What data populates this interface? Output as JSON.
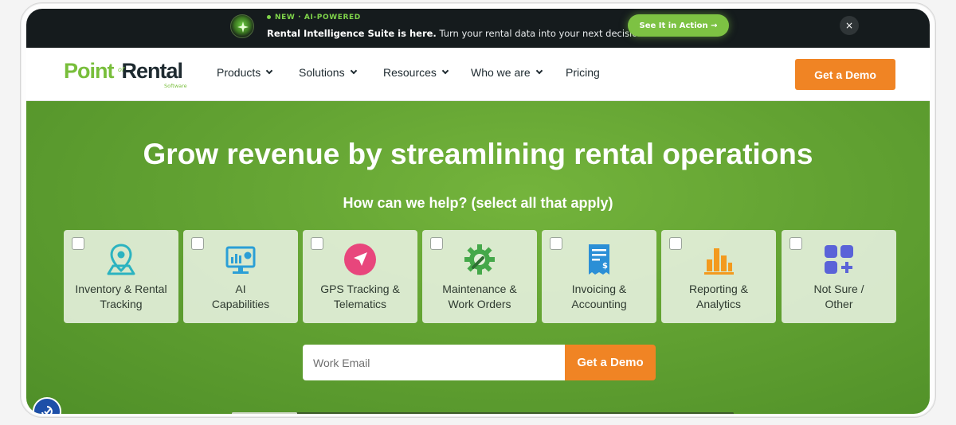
{
  "announcement": {
    "tagline": "NEW · AI-POWERED",
    "headline": "Rental Intelligence Suite is here.",
    "message": "Turn your rental data into your next decision.",
    "cta": "See It in Action →",
    "close": "×"
  },
  "logo": {
    "part1": "Point",
    "part2": "Rental",
    "connector": "of",
    "sub": "Software"
  },
  "nav": {
    "items": [
      {
        "label": "Products",
        "dropdown": true
      },
      {
        "label": "Solutions",
        "dropdown": true
      },
      {
        "label": "Resources",
        "dropdown": true
      },
      {
        "label": "Who we are",
        "dropdown": true
      },
      {
        "label": "Pricing",
        "dropdown": false
      }
    ],
    "demo_label": "Get a Demo"
  },
  "hero": {
    "title": "Grow revenue by streamlining rental operations",
    "subtitle": "How can we help? (select all that apply)",
    "options": [
      {
        "line1": "Inventory & Rental",
        "line2": "Tracking",
        "icon": "map-pin-icon",
        "checked": false
      },
      {
        "line1": "AI",
        "line2": "Capabilities",
        "icon": "dashboard-monitor-icon",
        "checked": false
      },
      {
        "line1": "GPS Tracking &",
        "line2": "Telematics",
        "icon": "navigation-arrow-icon",
        "checked": false
      },
      {
        "line1": "Maintenance &",
        "line2": "Work Orders",
        "icon": "wrench-gear-icon",
        "checked": false
      },
      {
        "line1": "Invoicing &",
        "line2": "Accounting",
        "icon": "receipt-icon",
        "checked": false
      },
      {
        "line1": "Reporting &",
        "line2": "Analytics",
        "icon": "bar-chart-icon",
        "checked": false
      },
      {
        "line1": "Not Sure /",
        "line2": "Other",
        "icon": "grid-plus-icon",
        "checked": false
      }
    ],
    "email_placeholder": "Work Email",
    "email_value": "",
    "submit_label": "Get a Demo"
  },
  "colors": {
    "brand_green": "#78be3b",
    "hero_green": "#62a232",
    "cta_orange": "#f08424",
    "dark_bar": "#151b1d",
    "icon_teal": "#2bb3c0",
    "icon_pink": "#e8467c",
    "icon_green": "#45a84a",
    "icon_blue": "#2b8fd6",
    "icon_orange": "#f39a1e",
    "icon_indigo": "#5a63d8"
  }
}
